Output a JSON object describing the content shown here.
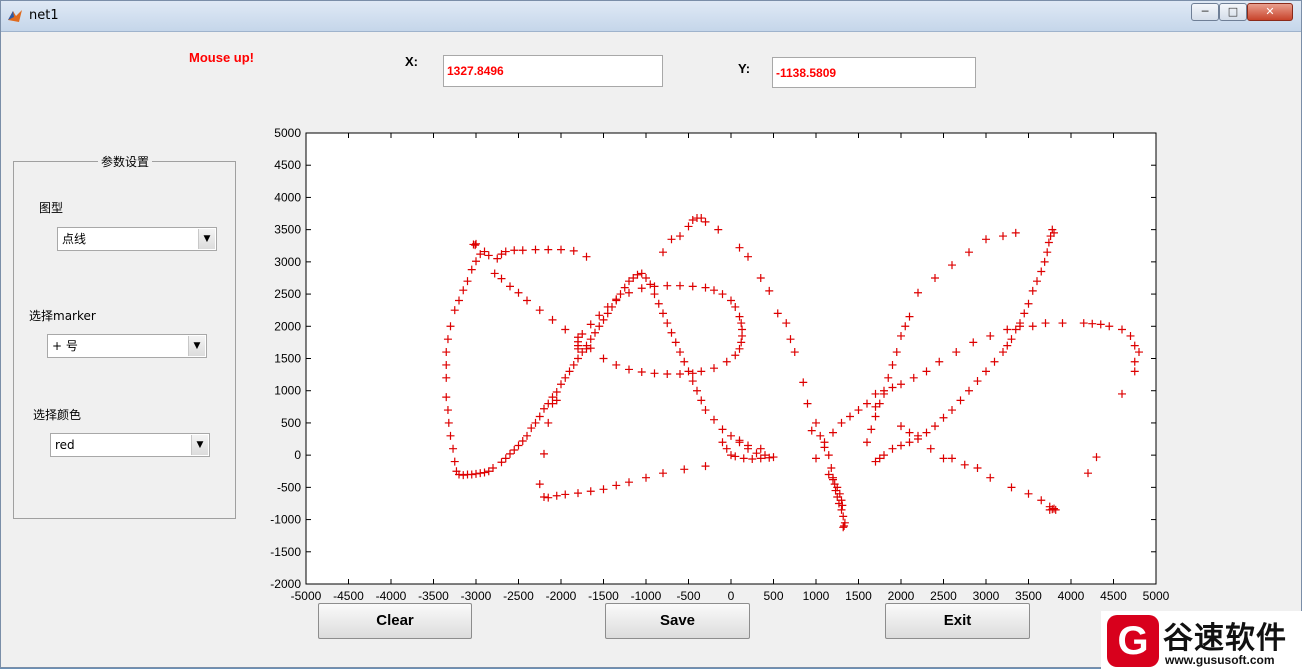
{
  "window": {
    "title": "net1",
    "buttons": {
      "minimize": "─",
      "maximize": "□",
      "close": "✕"
    }
  },
  "status": "Mouse up!",
  "coords": {
    "x_label": "X:",
    "x_value": "1327.8496",
    "y_label": "Y:",
    "y_value": "-1138.5809"
  },
  "panel": {
    "title": "参数设置",
    "shape_label": "图型",
    "shape_value": "点线",
    "marker_label": "选择marker",
    "marker_value": "+ 号",
    "color_label": "选择颜色",
    "color_value": "red"
  },
  "buttons": {
    "clear": "Clear",
    "save": "Save",
    "exit": "Exit"
  },
  "watermark": {
    "logo": "G",
    "name": "谷速软件",
    "url": "www.gususoft.com"
  },
  "colors": {
    "marker": "#dd0000",
    "status": "#ff0000"
  },
  "icons": {
    "dropdown": "chevron-down-icon",
    "app": "matlab-icon"
  },
  "chart_data": {
    "type": "scatter",
    "marker": "+",
    "color": "red",
    "xlim": [
      -5000,
      5000
    ],
    "ylim": [
      -2000,
      5000
    ],
    "xticks": [
      -5000,
      -4500,
      -4000,
      -3500,
      -3000,
      -2500,
      -2000,
      -1500,
      -1000,
      -500,
      0,
      500,
      1000,
      1500,
      2000,
      2500,
      3000,
      3500,
      4000,
      4500,
      5000
    ],
    "yticks": [
      -2000,
      -1500,
      -1000,
      -500,
      0,
      500,
      1000,
      1500,
      2000,
      2500,
      3000,
      3500,
      4000,
      4500,
      5000
    ],
    "grid": false,
    "strokes": [
      [
        [
          -3030,
          3270
        ],
        [
          -3010,
          3260
        ],
        [
          -3000,
          3280
        ]
      ],
      [
        [
          -2900,
          3160
        ],
        [
          -2950,
          3120
        ],
        [
          -3000,
          3010
        ],
        [
          -3050,
          2880
        ],
        [
          -3100,
          2700
        ],
        [
          -3150,
          2560
        ],
        [
          -3200,
          2400
        ],
        [
          -3250,
          2250
        ],
        [
          -3300,
          2000
        ],
        [
          -3330,
          1800
        ],
        [
          -3350,
          1600
        ],
        [
          -3350,
          1400
        ],
        [
          -3350,
          1200
        ],
        [
          -3350,
          900
        ],
        [
          -3330,
          700
        ],
        [
          -3320,
          500
        ],
        [
          -3300,
          300
        ],
        [
          -3270,
          100
        ],
        [
          -3250,
          -100
        ],
        [
          -3230,
          -250
        ],
        [
          -3200,
          -300
        ],
        [
          -3150,
          -310
        ],
        [
          -3100,
          -300
        ],
        [
          -3050,
          -300
        ],
        [
          -3000,
          -290
        ],
        [
          -2950,
          -280
        ],
        [
          -2900,
          -270
        ],
        [
          -2850,
          -250
        ],
        [
          -2800,
          -200
        ],
        [
          -2700,
          -110
        ],
        [
          -2650,
          -50
        ],
        [
          -2600,
          20
        ],
        [
          -2550,
          80
        ],
        [
          -2500,
          150
        ],
        [
          -2450,
          220
        ],
        [
          -2400,
          300
        ],
        [
          -2350,
          420
        ],
        [
          -2300,
          500
        ],
        [
          -2250,
          600
        ],
        [
          -2200,
          720
        ],
        [
          -2150,
          800
        ],
        [
          -2100,
          900
        ],
        [
          -2050,
          980
        ],
        [
          -2000,
          1100
        ],
        [
          -1950,
          1200
        ],
        [
          -1900,
          1300
        ],
        [
          -1850,
          1400
        ],
        [
          -1800,
          1500
        ],
        [
          -1750,
          1600
        ],
        [
          -1700,
          1700
        ],
        [
          -1650,
          1800
        ],
        [
          -1600,
          1900
        ],
        [
          -1550,
          2000
        ],
        [
          -1500,
          2100
        ],
        [
          -1450,
          2200
        ],
        [
          -1400,
          2300
        ],
        [
          -1350,
          2400
        ],
        [
          -1300,
          2500
        ],
        [
          -1250,
          2600
        ],
        [
          -1200,
          2700
        ],
        [
          -1150,
          2750
        ],
        [
          -1100,
          2800
        ],
        [
          -1050,
          2820
        ],
        [
          -1000,
          2750
        ],
        [
          -950,
          2650
        ],
        [
          -900,
          2500
        ],
        [
          -850,
          2350
        ],
        [
          -800,
          2200
        ],
        [
          -750,
          2050
        ],
        [
          -700,
          1900
        ],
        [
          -650,
          1750
        ],
        [
          -600,
          1600
        ],
        [
          -550,
          1450
        ],
        [
          -500,
          1300
        ],
        [
          -450,
          1150
        ],
        [
          -400,
          1000
        ],
        [
          -350,
          850
        ],
        [
          -300,
          700
        ],
        [
          -200,
          550
        ],
        [
          -100,
          400
        ],
        [
          0,
          300
        ],
        [
          100,
          200
        ],
        [
          200,
          100
        ],
        [
          300,
          30
        ],
        [
          400,
          0
        ],
        [
          500,
          -30
        ]
      ],
      [
        [
          -2850,
          3100
        ],
        [
          -2750,
          3050
        ],
        [
          -2700,
          3120
        ],
        [
          -2650,
          3160
        ],
        [
          -2550,
          3180
        ],
        [
          -2450,
          3180
        ],
        [
          -2300,
          3190
        ],
        [
          -2150,
          3190
        ],
        [
          -2000,
          3190
        ],
        [
          -1850,
          3170
        ],
        [
          -1700,
          3080
        ]
      ],
      [
        [
          -2780,
          2820
        ],
        [
          -2700,
          2740
        ],
        [
          -2600,
          2620
        ],
        [
          -2500,
          2520
        ],
        [
          -2400,
          2400
        ],
        [
          -2250,
          2250
        ],
        [
          -2100,
          2100
        ],
        [
          -1950,
          1950
        ],
        [
          -1800,
          1830
        ],
        [
          -1650,
          1660
        ],
        [
          -1500,
          1500
        ],
        [
          -1350,
          1400
        ],
        [
          -1200,
          1330
        ],
        [
          -1050,
          1290
        ],
        [
          -900,
          1270
        ],
        [
          -750,
          1260
        ],
        [
          -600,
          1260
        ],
        [
          -450,
          1270
        ],
        [
          -350,
          1300
        ],
        [
          -200,
          1350
        ],
        [
          -50,
          1450
        ],
        [
          50,
          1550
        ],
        [
          100,
          1650
        ],
        [
          120,
          1750
        ],
        [
          130,
          1850
        ],
        [
          130,
          1950
        ],
        [
          120,
          2050
        ],
        [
          100,
          2150
        ],
        [
          50,
          2300
        ],
        [
          0,
          2400
        ],
        [
          -100,
          2500
        ],
        [
          -200,
          2560
        ],
        [
          -300,
          2600
        ],
        [
          -450,
          2620
        ],
        [
          -600,
          2630
        ],
        [
          -750,
          2630
        ],
        [
          -900,
          2620
        ],
        [
          -1050,
          2590
        ],
        [
          -1200,
          2520
        ],
        [
          -1350,
          2420
        ],
        [
          -1450,
          2300
        ],
        [
          -1550,
          2170
        ],
        [
          -1650,
          2030
        ],
        [
          -1750,
          1880
        ],
        [
          -1800,
          1760
        ],
        [
          -1800,
          1700
        ],
        [
          -1700,
          1650
        ],
        [
          -1800,
          1650
        ]
      ],
      [
        [
          -500,
          3550
        ],
        [
          -450,
          3650
        ],
        [
          -400,
          3680
        ],
        [
          -350,
          3680
        ],
        [
          -300,
          3620
        ],
        [
          -150,
          3500
        ],
        [
          -600,
          3400
        ],
        [
          -700,
          3350
        ],
        [
          -800,
          3150
        ]
      ],
      [
        [
          100,
          3220
        ],
        [
          200,
          3080
        ],
        [
          350,
          2750
        ],
        [
          450,
          2550
        ],
        [
          550,
          2200
        ],
        [
          650,
          2050
        ],
        [
          700,
          1800
        ],
        [
          750,
          1600
        ],
        [
          850,
          1130
        ],
        [
          900,
          800
        ],
        [
          950,
          380
        ],
        [
          1000,
          500
        ],
        [
          1050,
          300
        ],
        [
          1100,
          120
        ],
        [
          1150,
          0
        ],
        [
          1180,
          -200
        ],
        [
          1200,
          -380
        ],
        [
          1220,
          -450
        ],
        [
          1230,
          -550
        ],
        [
          1250,
          -650
        ],
        [
          1270,
          -750
        ],
        [
          1300,
          -850
        ],
        [
          1320,
          -950
        ],
        [
          1340,
          -1050
        ],
        [
          1330,
          -1100
        ],
        [
          1320,
          -1120
        ]
      ],
      [
        [
          -2250,
          -450
        ],
        [
          -2200,
          -650
        ],
        [
          -2150,
          -660
        ],
        [
          -2050,
          -630
        ],
        [
          -1950,
          -610
        ],
        [
          -1800,
          -590
        ],
        [
          -1650,
          -560
        ],
        [
          -1500,
          -530
        ],
        [
          -1350,
          -470
        ],
        [
          -1200,
          -420
        ],
        [
          -1000,
          -350
        ],
        [
          -800,
          -280
        ],
        [
          -550,
          -220
        ],
        [
          -300,
          -170
        ]
      ],
      [
        [
          -2200,
          20
        ],
        [
          -2150,
          500
        ],
        [
          -2100,
          800
        ],
        [
          -2050,
          850
        ]
      ],
      [
        [
          4300,
          -30
        ],
        [
          4200,
          -280
        ],
        [
          4600,
          950
        ],
        [
          4750,
          1300
        ],
        [
          4750,
          1450
        ],
        [
          4800,
          1600
        ],
        [
          4750,
          1700
        ],
        [
          4700,
          1850
        ],
        [
          4600,
          1950
        ],
        [
          4450,
          2000
        ],
        [
          4350,
          2030
        ],
        [
          4250,
          2040
        ],
        [
          4150,
          2050
        ]
      ],
      [
        [
          3900,
          2050
        ],
        [
          3800,
          3450
        ],
        [
          3780,
          3500
        ],
        [
          3760,
          3400
        ],
        [
          3740,
          3300
        ],
        [
          3720,
          3150
        ],
        [
          3690,
          3000
        ],
        [
          3650,
          2850
        ],
        [
          3600,
          2700
        ],
        [
          3550,
          2550
        ],
        [
          3500,
          2350
        ],
        [
          3450,
          2200
        ],
        [
          3400,
          2050
        ],
        [
          3350,
          1950
        ],
        [
          3300,
          1800
        ],
        [
          3250,
          1700
        ],
        [
          3200,
          1600
        ],
        [
          3100,
          1450
        ],
        [
          3000,
          1300
        ],
        [
          2900,
          1150
        ],
        [
          2800,
          1000
        ],
        [
          2700,
          850
        ],
        [
          2600,
          700
        ],
        [
          2500,
          580
        ],
        [
          2400,
          450
        ],
        [
          2300,
          350
        ],
        [
          2200,
          250
        ],
        [
          2100,
          200
        ],
        [
          2000,
          150
        ],
        [
          1900,
          100
        ],
        [
          1800,
          0
        ],
        [
          1750,
          -50
        ],
        [
          1700,
          -100
        ]
      ],
      [
        [
          1600,
          200
        ],
        [
          1650,
          400
        ],
        [
          1700,
          600
        ],
        [
          1750,
          800
        ],
        [
          1800,
          1000
        ],
        [
          1850,
          1200
        ],
        [
          1900,
          1400
        ],
        [
          1950,
          1600
        ],
        [
          2000,
          1850
        ],
        [
          2050,
          2000
        ],
        [
          2100,
          2150
        ],
        [
          2200,
          2520
        ],
        [
          2400,
          2750
        ],
        [
          2600,
          2950
        ],
        [
          2800,
          3150
        ],
        [
          3000,
          3350
        ],
        [
          3200,
          3400
        ],
        [
          3350,
          3450
        ]
      ],
      [
        [
          1700,
          750
        ],
        [
          1800,
          950
        ],
        [
          1900,
          1050
        ],
        [
          2000,
          1100
        ],
        [
          2150,
          1200
        ],
        [
          2300,
          1300
        ],
        [
          2450,
          1450
        ],
        [
          2650,
          1600
        ],
        [
          2850,
          1750
        ],
        [
          3050,
          1850
        ],
        [
          3250,
          1950
        ],
        [
          3400,
          2000
        ],
        [
          3550,
          2000
        ],
        [
          3700,
          2050
        ]
      ],
      [
        [
          1000,
          -50
        ],
        [
          1100,
          200
        ],
        [
          1200,
          350
        ],
        [
          1300,
          500
        ],
        [
          1400,
          600
        ],
        [
          1500,
          700
        ],
        [
          1600,
          800
        ],
        [
          1700,
          950
        ]
      ],
      [
        [
          2000,
          450
        ],
        [
          2100,
          350
        ],
        [
          2200,
          300
        ],
        [
          2350,
          100
        ],
        [
          2500,
          -50
        ],
        [
          2600,
          -50
        ],
        [
          2750,
          -150
        ],
        [
          2900,
          -200
        ],
        [
          3050,
          -350
        ],
        [
          3300,
          -500
        ],
        [
          3500,
          -600
        ],
        [
          3650,
          -700
        ],
        [
          3750,
          -800
        ],
        [
          3800,
          -830
        ],
        [
          3820,
          -850
        ],
        [
          3780,
          -840
        ],
        [
          3750,
          -850
        ]
      ],
      [
        [
          1150,
          -300
        ],
        [
          1200,
          -350
        ],
        [
          1250,
          -500
        ],
        [
          1280,
          -600
        ],
        [
          1300,
          -700
        ],
        [
          1310,
          -780
        ]
      ],
      [
        [
          -100,
          200
        ],
        [
          -50,
          100
        ],
        [
          0,
          0
        ],
        [
          50,
          -20
        ],
        [
          150,
          -50
        ],
        [
          250,
          -60
        ],
        [
          350,
          -50
        ],
        [
          450,
          -40
        ],
        [
          350,
          100
        ],
        [
          200,
          150
        ],
        [
          100,
          230
        ]
      ]
    ]
  }
}
